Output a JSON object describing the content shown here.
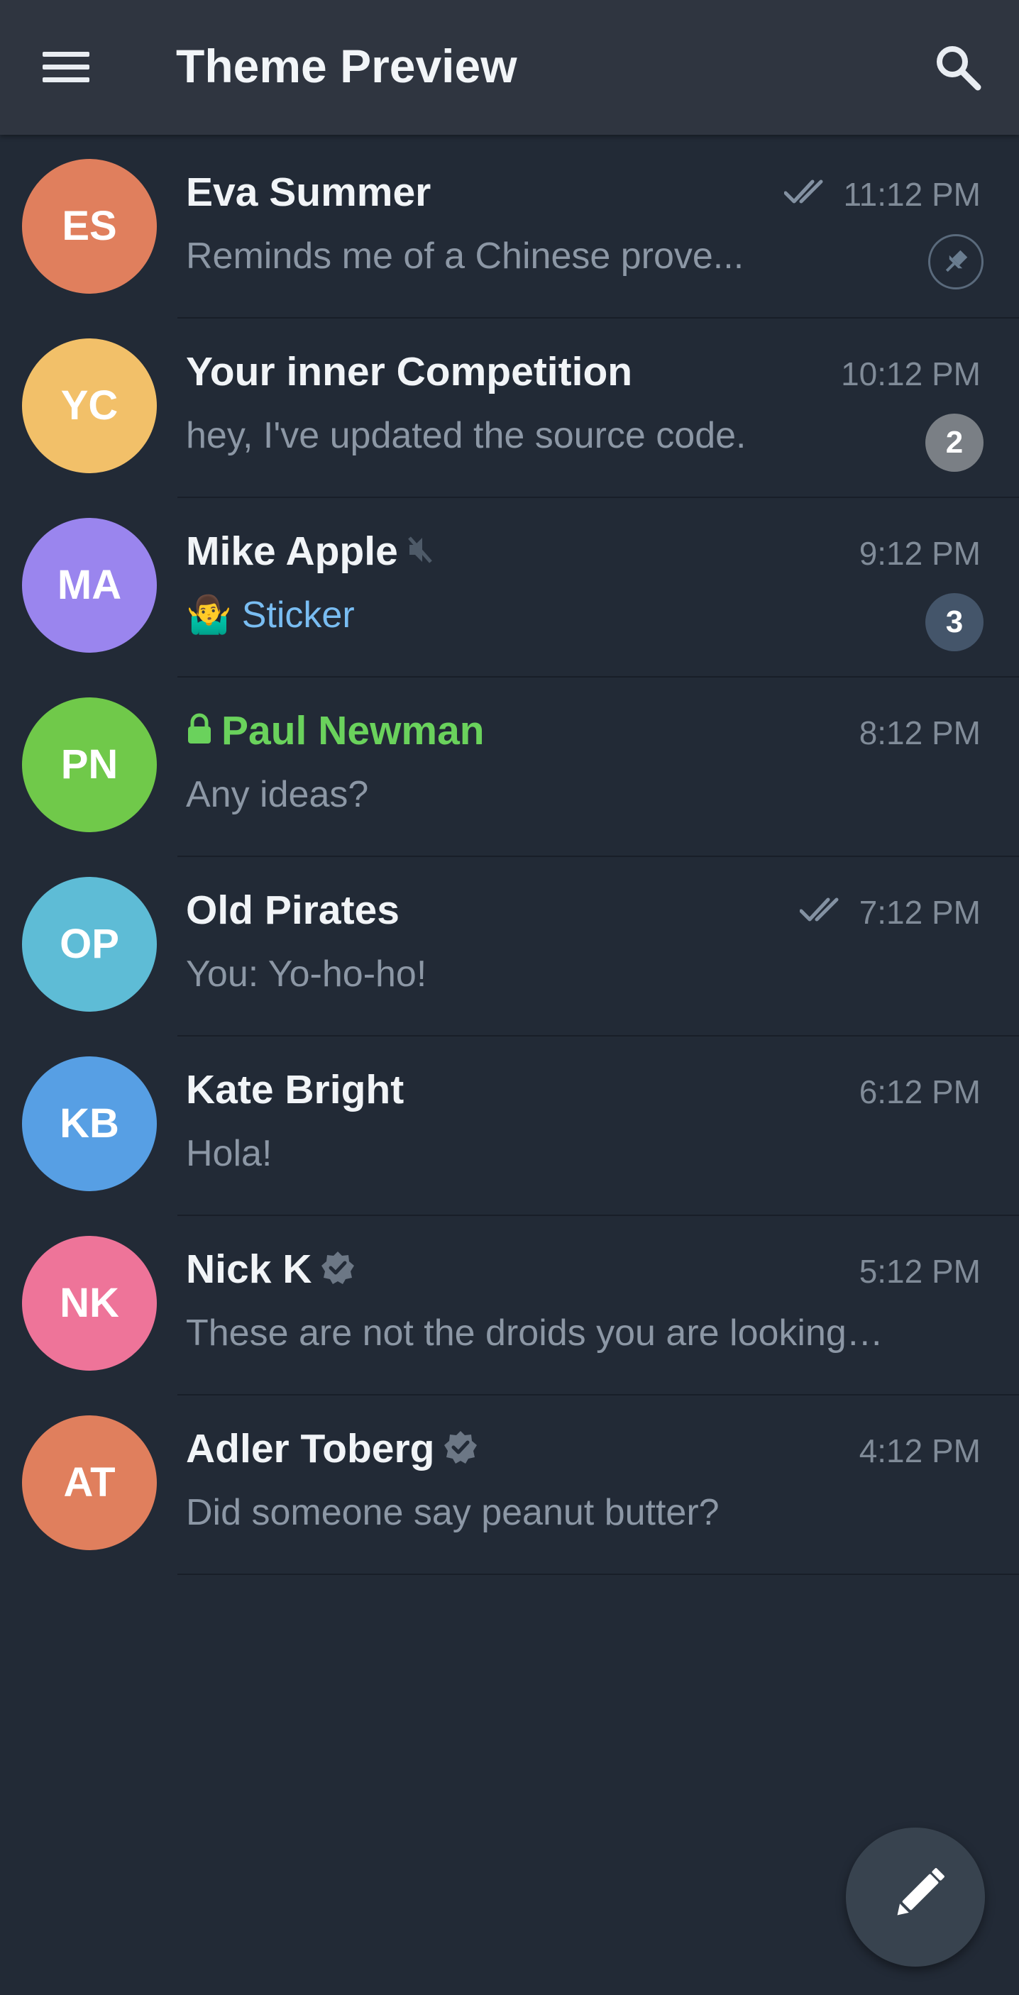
{
  "app_bar": {
    "title": "Theme Preview",
    "menu_icon": "hamburger-menu-icon",
    "search_icon": "search-icon"
  },
  "colors": {
    "app_bar_bg": "#2f3540",
    "list_bg": "#222a36",
    "secret_chat_name": "#6ad25c",
    "sticker_link": "#79bdf2",
    "unread_badge_default": "#7a7f85",
    "unread_badge_muted": "#44556a"
  },
  "chats": [
    {
      "initials": "ES",
      "avatar_color": "#e07f5d",
      "name": "Eva Summer",
      "message": "Reminds me of a Chinese prove...",
      "time": "11:12 PM",
      "read_receipt": "double-check-icon",
      "pinned": true
    },
    {
      "initials": "YC",
      "avatar_color": "#f2c069",
      "name": "Your inner Competition",
      "message": "hey, I've updated the source code.",
      "time": "10:12 PM",
      "unread": "2"
    },
    {
      "initials": "MA",
      "avatar_color": "#9a85ee",
      "name": "Mike Apple",
      "muted": true,
      "message_emoji": "🤷‍♂️",
      "message": "Sticker",
      "time": "9:12 PM",
      "unread": "3"
    },
    {
      "initials": "PN",
      "avatar_color": "#70c94a",
      "name": "Paul Newman",
      "secret": true,
      "message": "Any ideas?",
      "time": "8:12 PM"
    },
    {
      "initials": "OP",
      "avatar_color": "#5ebcd6",
      "name": "Old Pirates",
      "message": "You: Yo-ho-ho!",
      "time": "7:12 PM",
      "read_receipt": "double-check-icon"
    },
    {
      "initials": "KB",
      "avatar_color": "#579fe4",
      "name": "Kate Bright",
      "message": "Hola!",
      "time": "6:12 PM"
    },
    {
      "initials": "NK",
      "avatar_color": "#ee7499",
      "name": "Nick K",
      "verified": true,
      "message": "These are not the droids you are looking…",
      "time": "5:12 PM"
    },
    {
      "initials": "AT",
      "avatar_color": "#e07f5d",
      "name": "Adler Toberg",
      "verified": true,
      "message": "Did someone say peanut butter?",
      "time": "4:12 PM"
    }
  ],
  "fab": {
    "icon": "pencil-icon"
  }
}
